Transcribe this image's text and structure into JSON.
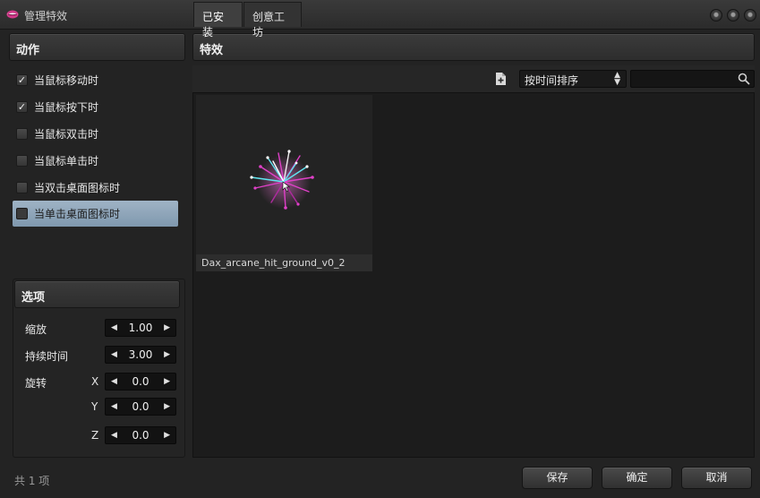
{
  "window": {
    "title": "管理特效"
  },
  "actions": {
    "header": "动作",
    "items": [
      {
        "label": "当鼠标移动时",
        "checked": true,
        "selected": false
      },
      {
        "label": "当鼠标按下时",
        "checked": true,
        "selected": false
      },
      {
        "label": "当鼠标双击时",
        "checked": false,
        "selected": false
      },
      {
        "label": "当鼠标单击时",
        "checked": false,
        "selected": false
      },
      {
        "label": "当双击桌面图标时",
        "checked": false,
        "selected": false
      },
      {
        "label": "当单击桌面图标时",
        "checked": false,
        "selected": true
      }
    ]
  },
  "options": {
    "header": "选项",
    "scale": {
      "label": "缩放",
      "value": "1.00"
    },
    "duration": {
      "label": "持续时间",
      "value": "3.00"
    },
    "rotation": {
      "label": "旋转",
      "x": {
        "axis": "X",
        "value": "0.0"
      },
      "y": {
        "axis": "Y",
        "value": "0.0"
      },
      "z": {
        "axis": "Z",
        "value": "0.0"
      }
    }
  },
  "effects": {
    "header": "特效",
    "tabs": [
      {
        "label": "已安装",
        "active": true
      },
      {
        "label": "创意工坊",
        "active": false
      }
    ],
    "sort": {
      "selected": "按时间排序"
    },
    "search": {
      "value": ""
    },
    "items": [
      {
        "name": "Dax_arcane_hit_ground_v0_2"
      }
    ]
  },
  "footer": {
    "count_text": "共 1 项",
    "save_label": "保存",
    "ok_label": "确定",
    "cancel_label": "取消"
  },
  "colors": {
    "background": "#232323",
    "selection": "#8fa5b9",
    "particle_magenta": "#e040c8",
    "particle_cyan": "#5fe6f0"
  },
  "icons": {
    "app": "pink-lips-logo",
    "new": "new-file-icon",
    "search": "search-icon",
    "window_buttons": [
      "minimize-icon",
      "maximize-icon",
      "close-icon"
    ]
  }
}
